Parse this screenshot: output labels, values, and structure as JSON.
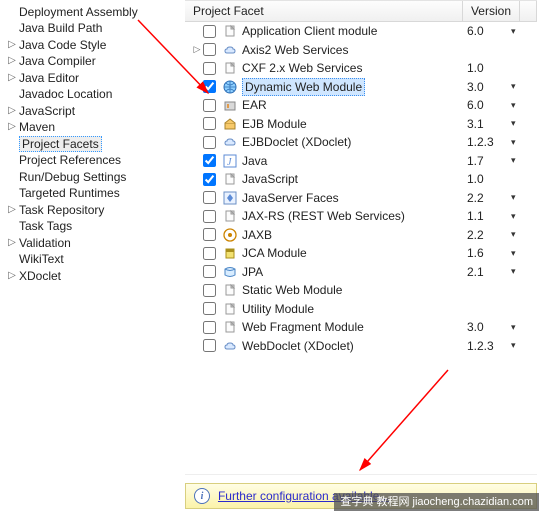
{
  "sidebar": {
    "items": [
      {
        "label": "Deployment Assembly",
        "expandable": false
      },
      {
        "label": "Java Build Path",
        "expandable": false
      },
      {
        "label": "Java Code Style",
        "expandable": true
      },
      {
        "label": "Java Compiler",
        "expandable": true
      },
      {
        "label": "Java Editor",
        "expandable": true
      },
      {
        "label": "Javadoc Location",
        "expandable": false
      },
      {
        "label": "JavaScript",
        "expandable": true
      },
      {
        "label": "Maven",
        "expandable": true
      },
      {
        "label": "Project Facets",
        "expandable": false,
        "selected": true
      },
      {
        "label": "Project References",
        "expandable": false
      },
      {
        "label": "Run/Debug Settings",
        "expandable": false
      },
      {
        "label": "Targeted Runtimes",
        "expandable": false
      },
      {
        "label": "Task Repository",
        "expandable": true
      },
      {
        "label": "Task Tags",
        "expandable": false
      },
      {
        "label": "Validation",
        "expandable": true
      },
      {
        "label": "WikiText",
        "expandable": false
      },
      {
        "label": "XDoclet",
        "expandable": true
      }
    ]
  },
  "table": {
    "col_facet": "Project Facet",
    "col_version": "Version",
    "rows": [
      {
        "expandable": false,
        "checked": false,
        "icon": "file",
        "name": "Application Client module",
        "ver": "6.0",
        "dd": true
      },
      {
        "expandable": true,
        "checked": false,
        "icon": "cloud",
        "name": "Axis2 Web Services",
        "ver": "",
        "dd": false
      },
      {
        "expandable": false,
        "checked": false,
        "icon": "file",
        "name": "CXF 2.x Web Services",
        "ver": "1.0",
        "dd": false
      },
      {
        "expandable": false,
        "checked": true,
        "icon": "globe",
        "name": "Dynamic Web Module",
        "ver": "3.0",
        "dd": true,
        "selected": true
      },
      {
        "expandable": false,
        "checked": false,
        "icon": "war",
        "name": "EAR",
        "ver": "6.0",
        "dd": true
      },
      {
        "expandable": false,
        "checked": false,
        "icon": "ejb",
        "name": "EJB Module",
        "ver": "3.1",
        "dd": true
      },
      {
        "expandable": false,
        "checked": false,
        "icon": "cloud",
        "name": "EJBDoclet (XDoclet)",
        "ver": "1.2.3",
        "dd": true
      },
      {
        "expandable": false,
        "checked": true,
        "icon": "java",
        "name": "Java",
        "ver": "1.7",
        "dd": true
      },
      {
        "expandable": false,
        "checked": true,
        "icon": "file",
        "name": "JavaScript",
        "ver": "1.0",
        "dd": false
      },
      {
        "expandable": false,
        "checked": false,
        "icon": "jsf",
        "name": "JavaServer Faces",
        "ver": "2.2",
        "dd": true
      },
      {
        "expandable": false,
        "checked": false,
        "icon": "file",
        "name": "JAX-RS (REST Web Services)",
        "ver": "1.1",
        "dd": true
      },
      {
        "expandable": false,
        "checked": false,
        "icon": "jaxb",
        "name": "JAXB",
        "ver": "2.2",
        "dd": true
      },
      {
        "expandable": false,
        "checked": false,
        "icon": "jar",
        "name": "JCA Module",
        "ver": "1.6",
        "dd": true
      },
      {
        "expandable": false,
        "checked": false,
        "icon": "jpa",
        "name": "JPA",
        "ver": "2.1",
        "dd": true
      },
      {
        "expandable": false,
        "checked": false,
        "icon": "file",
        "name": "Static Web Module",
        "ver": "",
        "dd": false
      },
      {
        "expandable": false,
        "checked": false,
        "icon": "file",
        "name": "Utility Module",
        "ver": "",
        "dd": false
      },
      {
        "expandable": false,
        "checked": false,
        "icon": "file",
        "name": "Web Fragment Module",
        "ver": "3.0",
        "dd": true
      },
      {
        "expandable": false,
        "checked": false,
        "icon": "cloud",
        "name": "WebDoclet (XDoclet)",
        "ver": "1.2.3",
        "dd": true
      }
    ]
  },
  "infobar": {
    "icon_letter": "i",
    "link_text": "Further configuration available..."
  },
  "watermark": "查字典 教程网  jiaocheng.chazidian.com",
  "colors": {
    "arrow": "#ff0000",
    "selection_bg": "#cfe6ff",
    "infobar_bg_top": "#fffde4",
    "infobar_bg_bottom": "#fbf3a9",
    "link": "#2b2bcc"
  }
}
